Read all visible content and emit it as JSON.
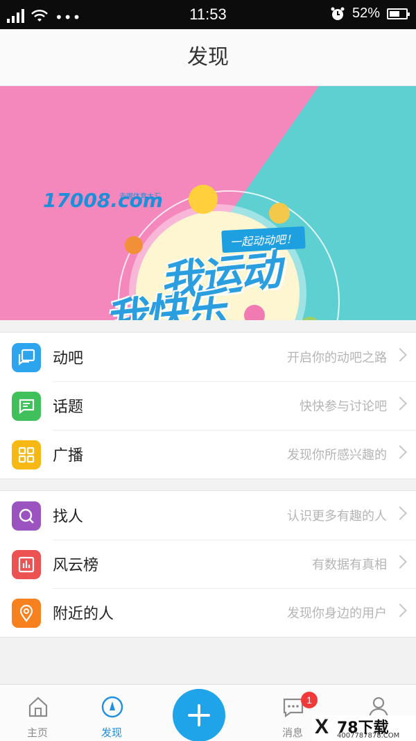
{
  "status_bar": {
    "time": "11:53",
    "battery": "52%",
    "overflow": "•••",
    "icons": [
      "signal-icon",
      "wifi-icon",
      "more-dots-icon",
      "alarm-icon",
      "battery-icon"
    ]
  },
  "header": {
    "title": "发现"
  },
  "banner": {
    "logo_text": "17008.com",
    "logo_sub": "去哪体育大汇",
    "tagline": "一起动动吧！",
    "slogan_line1": "我运动",
    "slogan_line2": "我快乐",
    "active_slide": 2,
    "slide_count": 4
  },
  "menu_groups": [
    [
      {
        "label": "动吧",
        "hint": "开启你的动吧之路",
        "icon": "chat-square-icon",
        "color": "#2ca5ee"
      },
      {
        "label": "话题",
        "hint": "快快参与讨论吧",
        "icon": "message-lines-icon",
        "color": "#3fc05a"
      },
      {
        "label": "广播",
        "hint": "发现你所感兴趣的",
        "icon": "grid-icon",
        "color": "#f7b813"
      }
    ],
    [
      {
        "label": "找人",
        "hint": "认识更多有趣的人",
        "icon": "search-icon",
        "color": "#9a53bf"
      },
      {
        "label": "风云榜",
        "hint": "有数据有真相",
        "icon": "bar-chart-icon",
        "color": "#ec5252"
      },
      {
        "label": "附近的人",
        "hint": "发现你身边的用户",
        "icon": "location-pin-icon",
        "color": "#f7811e"
      }
    ]
  ],
  "tabbar": {
    "home": "主页",
    "discover": "发现",
    "messages": "消息",
    "profile": "",
    "message_badge": "1",
    "active_color": "#1f8fe0"
  },
  "watermark": {
    "title": "78下载",
    "url": "4007787878.COM",
    "mark": "X"
  }
}
